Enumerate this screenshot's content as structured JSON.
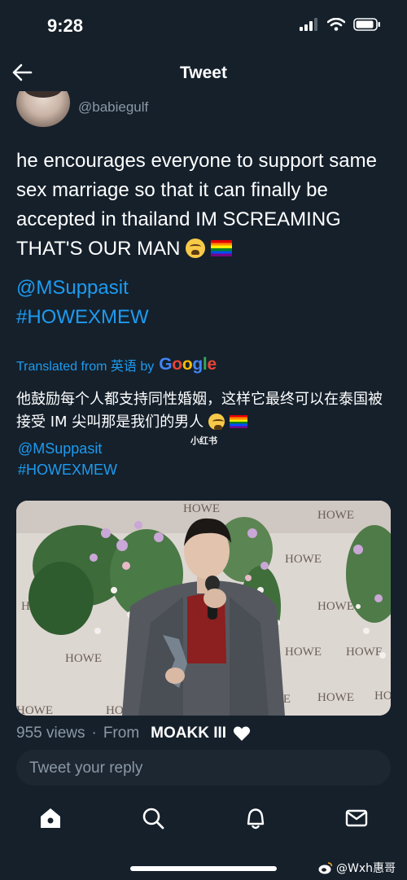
{
  "status_bar": {
    "time": "9:28"
  },
  "header": {
    "title": "Tweet"
  },
  "author": {
    "handle": "@babiegulf"
  },
  "tweet": {
    "text": "he encourages everyone to support same sex marriage so that it can finally be accepted in thailand IM SCREAMING THAT'S OUR MAN",
    "mention": "@MSuppasit",
    "hashtag": "#HOWEXMEW"
  },
  "translation": {
    "label": "Translated from 英语 by",
    "provider": "Google",
    "text": "他鼓励每个人都支持同性婚姻，这样它最终可以在泰国被接受 IM 尖叫那是我们的男人",
    "mention": "@MSuppasit",
    "hashtag": "#HOWEXMEW"
  },
  "overlay_watermark": "小红书",
  "media": {
    "backdrop_text": [
      "HOWE",
      "HOWE",
      "HOWE",
      "HOWE",
      "HOWE",
      "HOWE",
      "HOWE",
      "HOWE",
      "HOWE",
      "HOWE",
      "HOWE",
      "HOWE",
      "HOWE"
    ]
  },
  "meta": {
    "views": "955 views",
    "separator": "·",
    "from_label": "From",
    "app": "MOAKK III"
  },
  "reply": {
    "placeholder": "Tweet your reply"
  },
  "tabs": [
    "home",
    "search",
    "notifications",
    "messages"
  ],
  "footer_watermark": "@Wxh惠哥",
  "colors": {
    "background": "#15202b",
    "accent": "#1d9bf0",
    "muted": "#8b98a5"
  }
}
